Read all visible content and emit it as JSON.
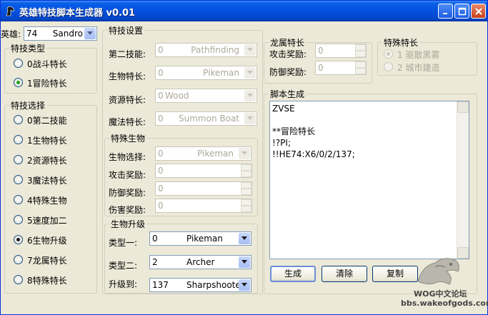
{
  "window": {
    "title": "英雄特技脚本生成器 v0.01"
  },
  "hero": {
    "label": "英雄:",
    "selected_num": "74",
    "selected_name": "Sandro"
  },
  "skill_type": {
    "title": "特技类型",
    "options": [
      "0战斗特长",
      "1冒险特长"
    ],
    "selected": 1
  },
  "skill_choice": {
    "title": "特技选择",
    "options": [
      "0第二技能",
      "1生物特长",
      "2资源特长",
      "3魔法特长",
      "4特殊生物",
      "5速度加二",
      "6生物升级",
      "7龙属特长",
      "8特殊特长"
    ],
    "selected": 6
  },
  "skill_settings": {
    "title": "特技设置",
    "fields": [
      {
        "label": "第二技能:",
        "num": "0",
        "name": "Pathfinding"
      },
      {
        "label": "生物特长:",
        "num": "0",
        "name": "Pikeman"
      },
      {
        "label": "资源特长:",
        "num": "0",
        "name": "Wood"
      },
      {
        "label": "魔法特长:",
        "num": "0",
        "name": "Summon Boat"
      }
    ]
  },
  "special_creature": {
    "title": "特殊生物",
    "select_label": "生物选择:",
    "select_num": "0",
    "select_name": "Pikeman",
    "spins": [
      {
        "label": "攻击奖励:",
        "value": "0"
      },
      {
        "label": "防御奖励:",
        "value": "0"
      },
      {
        "label": "伤害奖励:",
        "value": "0"
      }
    ]
  },
  "creature_upgrade": {
    "title": "生物升级",
    "fields": [
      {
        "label": "类型一:",
        "num": "0",
        "name": "Pikeman"
      },
      {
        "label": "类型二:",
        "num": "2",
        "name": "Archer"
      },
      {
        "label": "升级到:",
        "num": "137",
        "name": "Sharpshooter"
      }
    ]
  },
  "dragon": {
    "title": "龙属特长",
    "spins": [
      {
        "label": "攻击奖励:",
        "value": "0"
      },
      {
        "label": "防御奖励:",
        "value": "0"
      }
    ]
  },
  "special_skill": {
    "title": "特殊特长",
    "options": [
      "1 驱散黑雾",
      "2 城市建造"
    ],
    "selected": 0
  },
  "script": {
    "title": "脚本生成",
    "lines": [
      "ZVSE",
      "",
      "**冒险特长",
      "!?PI;",
      "!!HE74:X6/0/2/137;"
    ]
  },
  "buttons": {
    "generate": "生成",
    "clear": "清除",
    "copy": "复制"
  },
  "watermark": {
    "line1": "WOG中文论坛",
    "line2": "bbs.wakeofgods.com"
  },
  "colors": {
    "titlebar": "#0550df",
    "face": "#ece9d8",
    "radio_selected": "#21a121"
  }
}
